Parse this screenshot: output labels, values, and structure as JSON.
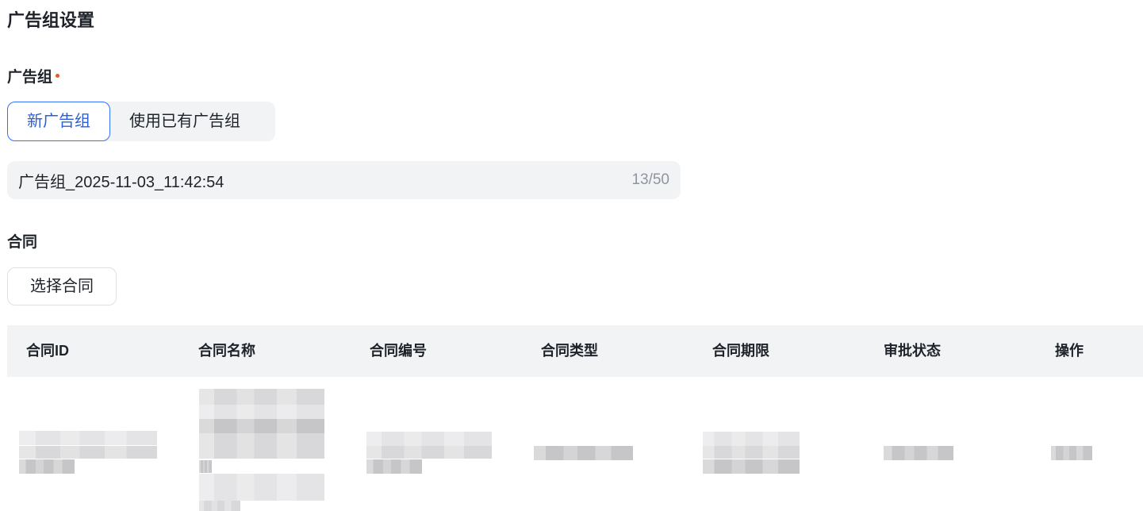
{
  "section_title": "广告组设置",
  "adgroup": {
    "label": "广告组",
    "options": [
      "新广告组",
      "使用已有广告组"
    ],
    "selected": "新广告组",
    "name_value": "广告组_2025-11-03_11:42:54",
    "char_count": "13/50"
  },
  "contract": {
    "label": "合同",
    "select_button": "选择合同",
    "columns": [
      "合同ID",
      "合同名称",
      "合同编号",
      "合同类型",
      "合同期限",
      "审批状态",
      "操作"
    ]
  },
  "colors": {
    "accent": "#3370ff",
    "required": "#e8572b",
    "panel": "#f2f3f5"
  }
}
